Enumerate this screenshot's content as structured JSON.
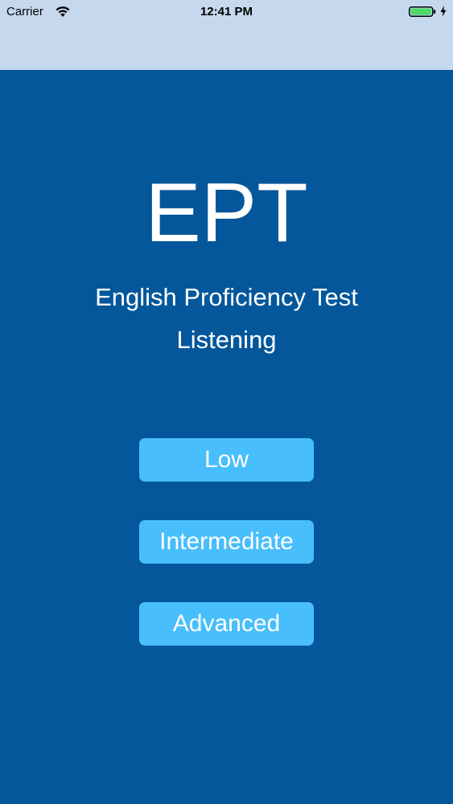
{
  "status_bar": {
    "carrier": "Carrier",
    "time": "12:41 PM",
    "wifi_icon": "wifi-icon",
    "battery_icon": "battery-icon",
    "charging_icon": "bolt-icon"
  },
  "header": {
    "title": "EPT",
    "subtitle": "English Proficiency Test",
    "section": "Listening"
  },
  "levels": {
    "low": "Low",
    "intermediate": "Intermediate",
    "advanced": "Advanced"
  },
  "colors": {
    "background": "#03579a",
    "nav_bar": "#c6d8ee",
    "button": "#48befc",
    "battery": "#4cd964",
    "text": "#ffffff"
  }
}
